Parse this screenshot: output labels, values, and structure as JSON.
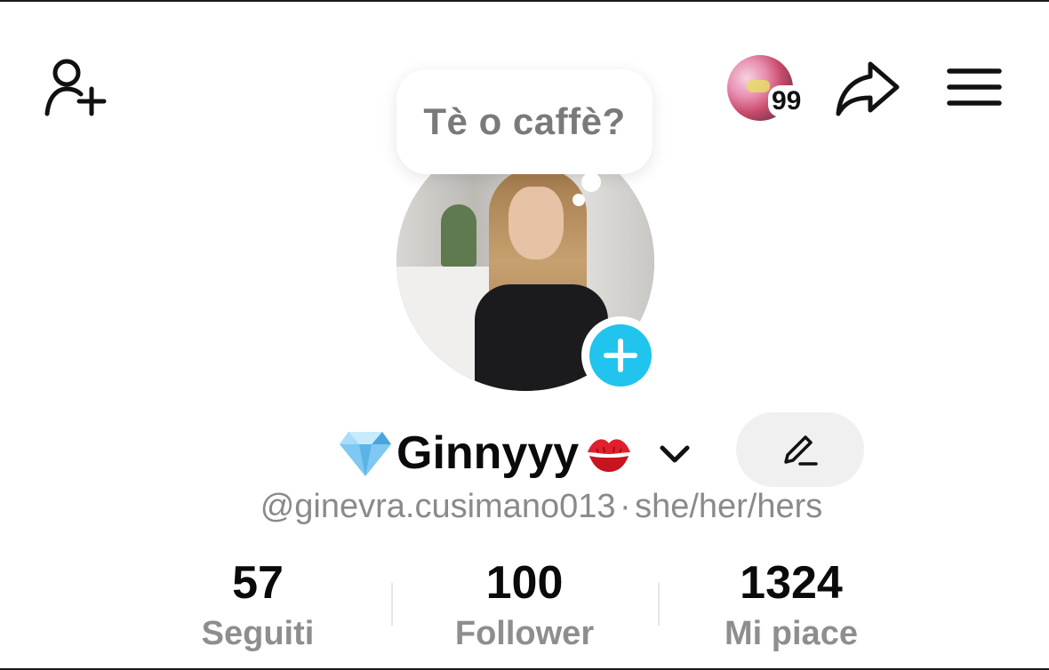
{
  "header": {
    "add_user_icon": "person-plus-icon",
    "story_badge_count": "99",
    "share_icon": "share-arrow-icon",
    "menu_icon": "hamburger-menu-icon"
  },
  "profile": {
    "note_bubble_text": "Tè o caffè?",
    "display_name": "Ginnyyy",
    "name_prefix_emoji": "gem-stone-icon",
    "name_suffix_emoji": "kiss-mark-icon",
    "username": "@ginevra.cusimano013",
    "separator": "·",
    "pronouns": "she/her/hers",
    "edit_icon": "pencil-icon"
  },
  "stats": [
    {
      "value": "57",
      "label": "Seguiti"
    },
    {
      "value": "100",
      "label": "Follower"
    },
    {
      "value": "1324",
      "label": "Mi piace"
    }
  ],
  "colors": {
    "accent_add": "#20c4ec",
    "edit_bg": "#f0f0f0",
    "secondary_text": "#8a8a8a"
  }
}
